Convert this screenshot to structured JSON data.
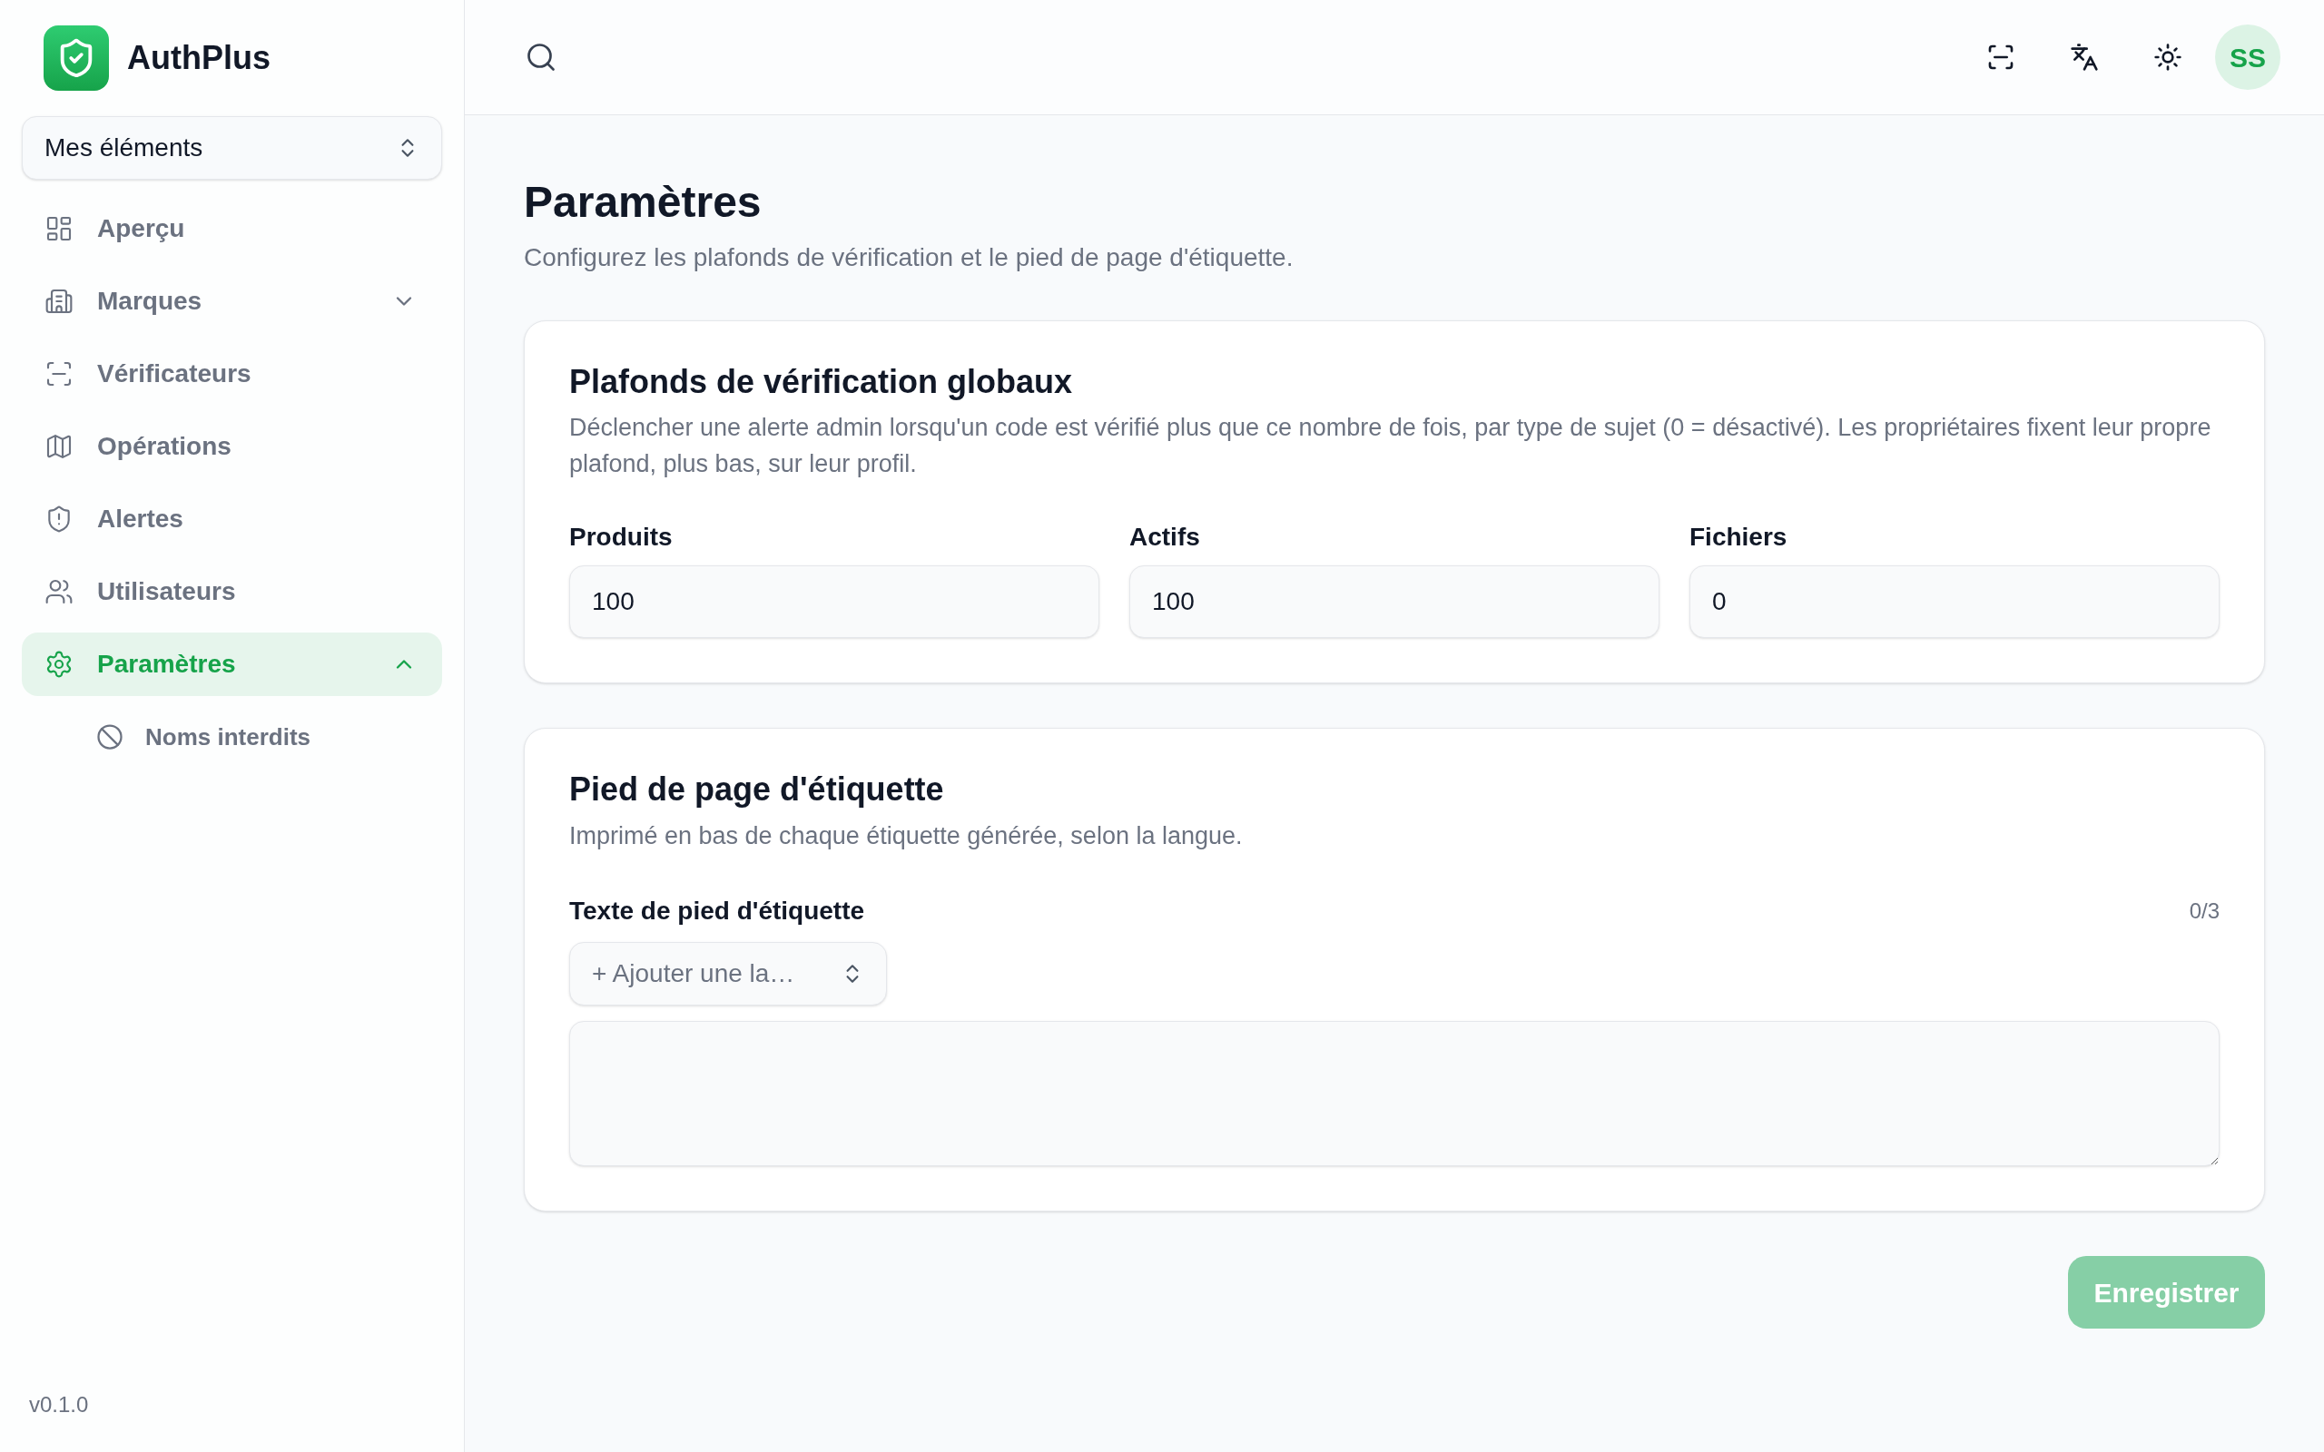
{
  "sidebar": {
    "brand": "AuthPlus",
    "scope_select": {
      "value": "Mes éléments"
    },
    "items": [
      {
        "label": "Aperçu",
        "kind": "link",
        "selected": false
      },
      {
        "label": "Marques",
        "kind": "group",
        "expanded": false,
        "selected": false
      },
      {
        "label": "Vérificateurs",
        "kind": "link",
        "selected": false
      },
      {
        "label": "Opérations",
        "kind": "link",
        "selected": false
      },
      {
        "label": "Alertes",
        "kind": "link",
        "selected": false
      },
      {
        "label": "Utilisateurs",
        "kind": "link",
        "selected": false
      },
      {
        "label": "Paramètres",
        "kind": "group",
        "expanded": true,
        "selected": true,
        "children": [
          {
            "label": "Noms interdits",
            "selected": false
          }
        ]
      }
    ],
    "version": "v0.1.0"
  },
  "top_bar": {
    "avatar": {
      "initials": "SS"
    }
  },
  "page": {
    "title": "Paramètres",
    "subtitle": "Configurez les plafonds de vérification et le pied de page d'étiquette."
  },
  "ceilings_card": {
    "title": "Plafonds de vérification globaux",
    "description": "Déclencher une alerte admin lorsqu'un code est vérifié plus que ce nombre de fois, par type de sujet (0 = désactivé). Les propriétaires fixent leur propre plafond, plus bas, sur leur profil.",
    "fields": [
      {
        "label": "Produits",
        "value": "100"
      },
      {
        "label": "Actifs",
        "value": "100"
      },
      {
        "label": "Fichiers",
        "value": "0"
      }
    ]
  },
  "footer_card": {
    "title": "Pied de page d'étiquette",
    "description": "Imprimé en bas de chaque étiquette générée, selon la langue.",
    "field_label": "Texte de pied d'étiquette",
    "counter": "0/3",
    "language_select": {
      "placeholder": "+ Ajouter une la…"
    }
  },
  "save_button": {
    "label": "Enregistrer",
    "disabled": true
  }
}
